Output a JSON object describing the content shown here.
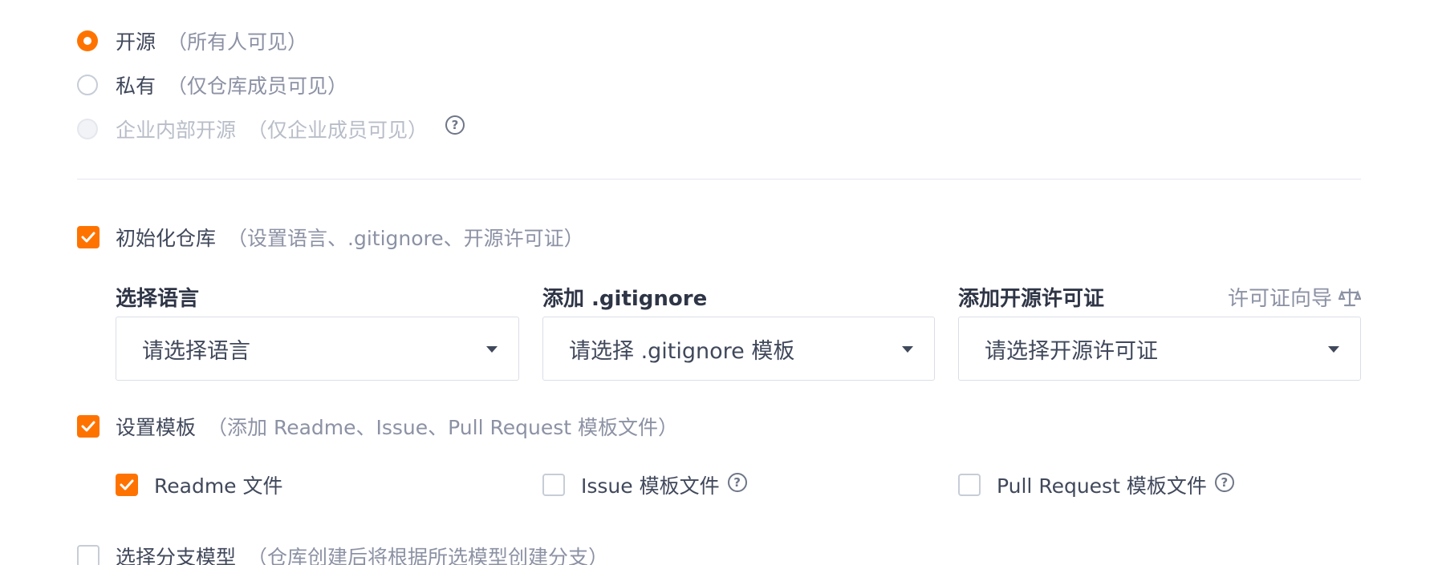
{
  "visibility": {
    "options": [
      {
        "label": "开源",
        "hint": "（所有人可见）",
        "checked": true,
        "disabled": false
      },
      {
        "label": "私有",
        "hint": "（仅仓库成员可见）",
        "checked": false,
        "disabled": false
      },
      {
        "label": "企业内部开源",
        "hint": "（仅企业成员可见）",
        "checked": false,
        "disabled": true
      }
    ],
    "help_symbol": "?"
  },
  "init_repo": {
    "label": "初始化仓库",
    "hint": "（设置语言、.gitignore、开源许可证）",
    "checked": true
  },
  "language": {
    "label": "选择语言",
    "placeholder": "请选择语言"
  },
  "gitignore": {
    "label": "添加 .gitignore",
    "placeholder": "请选择 .gitignore 模板"
  },
  "license": {
    "label": "添加开源许可证",
    "placeholder": "请选择开源许可证",
    "guide_link": "许可证向导"
  },
  "template": {
    "label": "设置模板",
    "hint": "（添加 Readme、Issue、Pull Request 模板文件）",
    "checked": true,
    "items": [
      {
        "label": "Readme 文件",
        "checked": true
      },
      {
        "label": "Issue 模板文件",
        "checked": false
      },
      {
        "label": "Pull Request 模板文件",
        "checked": false
      }
    ]
  },
  "branch_model": {
    "label": "选择分支模型",
    "hint": "（仓库创建后将根据所选模型创建分支）",
    "checked": false
  },
  "colors": {
    "accent": "#fe7300",
    "text": "#40485b",
    "hint_text": "#8c92a4",
    "disabled_text": "#b8bdc8",
    "border": "#dadee6"
  }
}
